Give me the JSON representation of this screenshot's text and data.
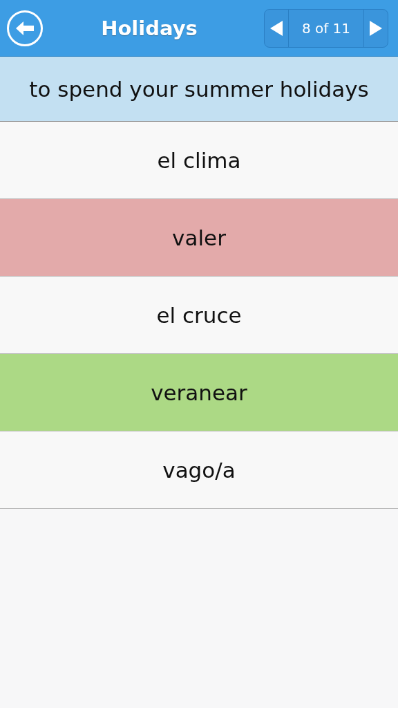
{
  "header": {
    "title": "Holidays",
    "pager": "8 of 11"
  },
  "prompt": "to spend your summer holidays",
  "options": [
    {
      "text": "el clima",
      "kind": "neutral"
    },
    {
      "text": "valer",
      "kind": "wrong"
    },
    {
      "text": "el cruce",
      "kind": "neutral"
    },
    {
      "text": "veranear",
      "kind": "correct"
    },
    {
      "text": "vago/a",
      "kind": "neutral"
    }
  ]
}
